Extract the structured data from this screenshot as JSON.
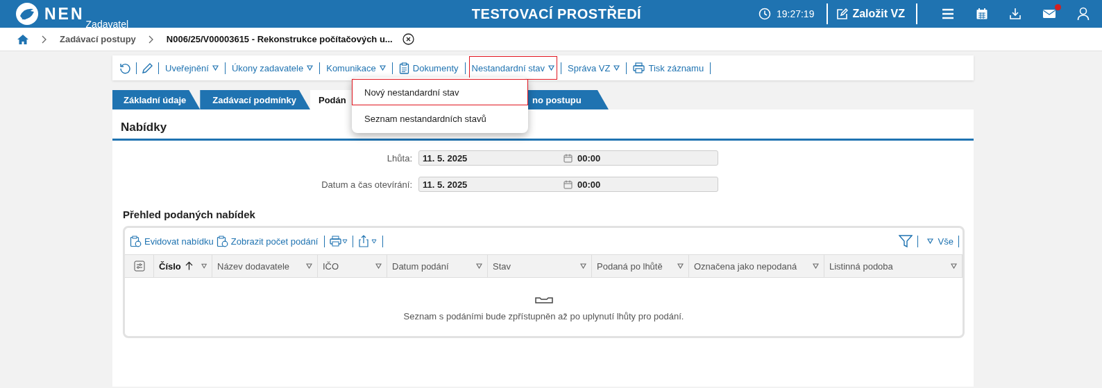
{
  "header": {
    "logo": "NEN",
    "role": "Zadavatel",
    "environment": "TESTOVACÍ PROSTŘEDÍ",
    "time": "19:27:19",
    "create_button": "Založit VZ",
    "mail_notification": true
  },
  "breadcrumb": [
    "Zadávací postupy",
    "N006/25/V00003615 - Rekonstrukce počítačových u..."
  ],
  "toolbar": [
    {
      "label": "Uveřejnění",
      "kind": "menu",
      "highlighted": false
    },
    {
      "label": "Úkony zadavatele",
      "kind": "menu",
      "highlighted": false
    },
    {
      "label": "Komunikace",
      "kind": "menu",
      "highlighted": false
    },
    {
      "label": "Dokumenty",
      "kind": "documents",
      "highlighted": false
    },
    {
      "label": "Nestandardní stav",
      "kind": "menu",
      "highlighted": true
    },
    {
      "label": "Správa VZ",
      "kind": "menu",
      "highlighted": false
    },
    {
      "label": "Tisk záznamu",
      "kind": "print",
      "highlighted": false
    }
  ],
  "dropdown": [
    {
      "label": "Nový nestandardní stav",
      "highlighted": true
    },
    {
      "label": "Seznam nestandardních stavů",
      "highlighted": false
    }
  ],
  "tabs": [
    {
      "label": "Základní údaje",
      "selected": false
    },
    {
      "label": "Zadávací podmínky",
      "selected": false
    },
    {
      "label": "Podán",
      "selected": true
    },
    {
      "label": "no postupu",
      "selected": false
    }
  ],
  "section_title": "Nabídky",
  "fields": [
    {
      "label": "Lhůta:",
      "date": "11. 5. 2025",
      "time": "00:00"
    },
    {
      "label": "Datum a čas otevírání:",
      "date": "11. 5. 2025",
      "time": "00:00"
    }
  ],
  "table_title": "Přehled podaných nabídek",
  "table_toolbar": [
    "Evidovat nabídku",
    "Zobrazit počet podání"
  ],
  "filter_label": "Vše",
  "table": {
    "columns": [
      {
        "label": "Číslo",
        "sorted": true
      },
      {
        "label": "Název dodavatele",
        "sorted": false
      },
      {
        "label": "IČO",
        "sorted": false
      },
      {
        "label": "Datum podání",
        "sorted": false
      },
      {
        "label": "Stav",
        "sorted": false
      },
      {
        "label": "Podaná po lhůtě",
        "sorted": false
      },
      {
        "label": "Označena jako nepodaná",
        "sorted": false
      },
      {
        "label": "Listinná podoba",
        "sorted": false
      }
    ],
    "empty_message": "Seznam s podáními bude zpřístupněn až po uplynutí lhůty pro podání."
  }
}
